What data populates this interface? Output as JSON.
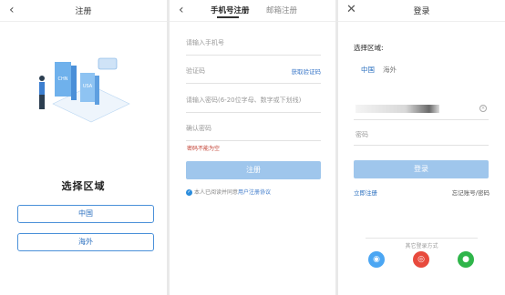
{
  "panel1": {
    "title": "注册",
    "region_title": "选择区域",
    "btn_china": "中国",
    "btn_overseas": "海外",
    "illus_label1": "CHN",
    "illus_label2": "USA"
  },
  "panel2": {
    "tab_phone": "手机号注册",
    "tab_mail": "邮箱注册",
    "phone_placeholder": "请输入手机号",
    "code_placeholder": "验证码",
    "get_code": "获取验证码",
    "password_placeholder": "请输入密码(6-20位字母、数字或下划线)",
    "confirm_placeholder": "确认密码",
    "error_text": "密码不能为空",
    "submit_label": "注册",
    "agree_text": "本人已阅读并同意",
    "agree_link": "用户注册协议"
  },
  "panel3": {
    "title": "登录",
    "select_region": "选择区域:",
    "region_china": "中国",
    "region_overseas": "海外",
    "password_placeholder": "密码",
    "login_label": "登录",
    "register_link": "立即注册",
    "forgot_link": "忘记账号/密码",
    "other_login": "其它登录方式"
  },
  "icons": {
    "back": "chevron-left-icon",
    "close": "close-icon",
    "qq": "qq-icon",
    "weibo": "weibo-icon",
    "wechat": "wechat-icon"
  },
  "colors": {
    "accent": "#2a6fbf",
    "button_disabled": "#9fc6ec",
    "error": "#c0392b"
  }
}
